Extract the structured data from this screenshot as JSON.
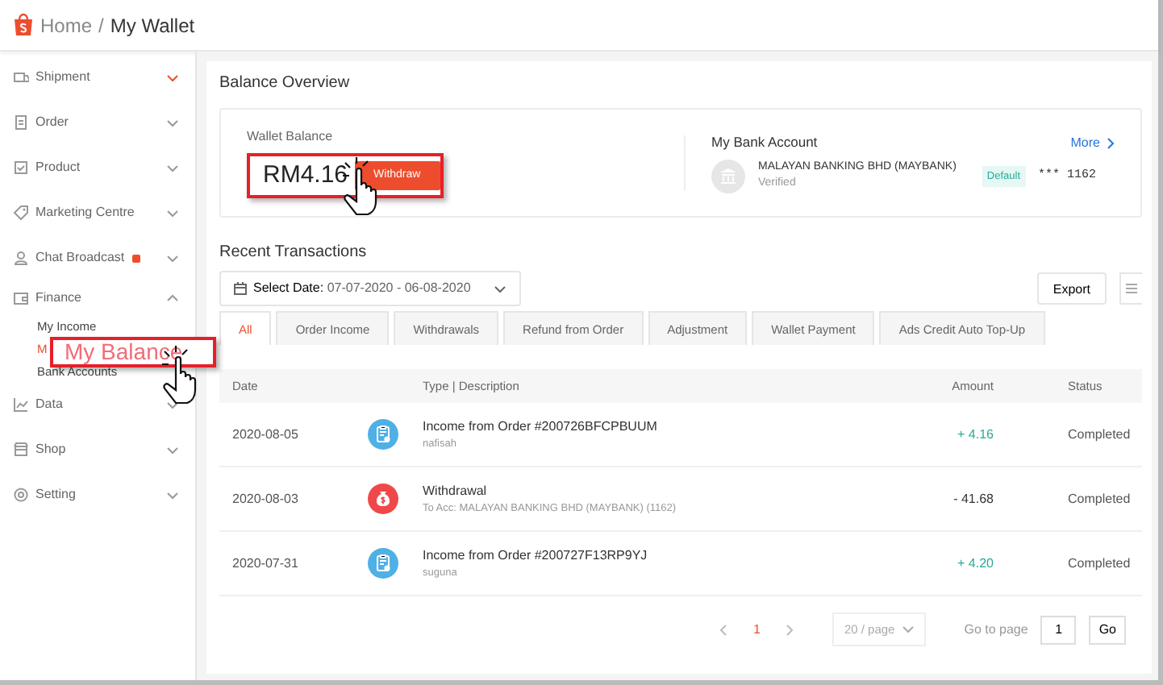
{
  "header": {
    "home": "Home",
    "separator": "/",
    "current": "My Wallet"
  },
  "sidebar": {
    "items": [
      {
        "label": "Shipment",
        "expanded": false,
        "hovered": true,
        "dot": false
      },
      {
        "label": "Order",
        "expanded": false,
        "hovered": false,
        "dot": false
      },
      {
        "label": "Product",
        "expanded": false,
        "hovered": false,
        "dot": false
      },
      {
        "label": "Marketing Centre",
        "expanded": false,
        "hovered": false,
        "dot": false
      },
      {
        "label": "Chat Broadcast",
        "expanded": false,
        "hovered": false,
        "dot": true
      },
      {
        "label": "Finance",
        "expanded": true,
        "hovered": false,
        "dot": false,
        "children": [
          {
            "label": "My Income",
            "selected": false
          },
          {
            "label": "M",
            "selected": true
          },
          {
            "label": "Bank Accounts",
            "selected": false
          }
        ]
      },
      {
        "label": "Data",
        "expanded": false,
        "hovered": false,
        "dot": false
      },
      {
        "label": "Shop",
        "expanded": false,
        "hovered": false,
        "dot": false
      },
      {
        "label": "Setting",
        "expanded": false,
        "hovered": false,
        "dot": false
      }
    ]
  },
  "balance_overview": {
    "title": "Balance Overview",
    "wallet_label": "Wallet Balance",
    "amount": "RM4.16",
    "withdraw_button": "Withdraw",
    "bank": {
      "title": "My Bank Account",
      "more": "More",
      "name": "MALAYAN BANKING BHD (MAYBANK)",
      "status": "Verified",
      "badge": "Default",
      "account": "*** 1162"
    }
  },
  "recent_transactions": {
    "title": "Recent Transactions",
    "date_label": "Select Date:",
    "date_range": "07-07-2020 - 06-08-2020",
    "export_button": "Export",
    "tabs": [
      {
        "label": "All",
        "selected": true
      },
      {
        "label": "Order Income",
        "selected": false
      },
      {
        "label": "Withdrawals",
        "selected": false
      },
      {
        "label": "Refund from Order",
        "selected": false
      },
      {
        "label": "Adjustment",
        "selected": false
      },
      {
        "label": "Wallet Payment",
        "selected": false
      },
      {
        "label": "Ads Credit Auto Top-Up",
        "selected": false
      }
    ],
    "columns": [
      "Date",
      "Type | Description",
      "Amount",
      "Status"
    ],
    "rows": [
      {
        "date": "2020-08-05",
        "kind": "income",
        "title": "Income from Order #200726BFCPBUUM",
        "description": "nafisah",
        "amount": "+ 4.16",
        "status": "Completed"
      },
      {
        "date": "2020-08-03",
        "kind": "withdrawal",
        "title": "Withdrawal",
        "description": "To Acc: MALAYAN BANKING BHD (MAYBANK) (1162)",
        "amount": "- 41.68",
        "status": "Completed"
      },
      {
        "date": "2020-07-31",
        "kind": "income",
        "title": "Income from Order #200727F13RP9YJ",
        "description": "suguna",
        "amount": "+ 4.20",
        "status": "Completed"
      }
    ],
    "pagination": {
      "pages": [
        {
          "label": "1",
          "selected": true
        }
      ],
      "page_size": "20 / page",
      "goto_label": "Go to page",
      "goto_value": "1",
      "go_button": "Go"
    }
  },
  "annotation": {
    "callout": "My Balance"
  }
}
